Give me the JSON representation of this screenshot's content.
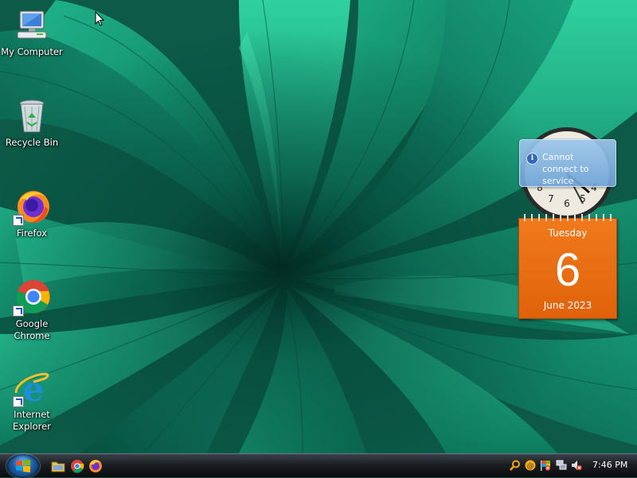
{
  "desktop": {
    "icons": [
      {
        "label": "My Computer",
        "icon": "computer-icon"
      },
      {
        "label": "Recycle Bin",
        "icon": "recycle-bin-icon"
      },
      {
        "label": "Firefox",
        "icon": "firefox-icon"
      },
      {
        "label": "Google Chrome",
        "icon": "chrome-icon"
      },
      {
        "label": "Internet Explorer",
        "icon": "internet-explorer-icon"
      }
    ]
  },
  "gadgets": {
    "clock": {
      "popup_text": "Cannot connect to service",
      "popup_icon": "info-icon"
    },
    "calendar": {
      "weekday": "Tuesday",
      "day": "6",
      "month_year": "June 2023",
      "color": "#e8680f"
    }
  },
  "taskbar": {
    "start_icon": "windows-logo-icon",
    "quick_launch": [
      "folder-icon",
      "chrome-icon",
      "firefox-icon"
    ],
    "tray_icons": [
      "search-icon",
      "update-icon",
      "flag-icon",
      "network-icon",
      "volume-muted-icon"
    ],
    "clock": "7:46 PM"
  }
}
